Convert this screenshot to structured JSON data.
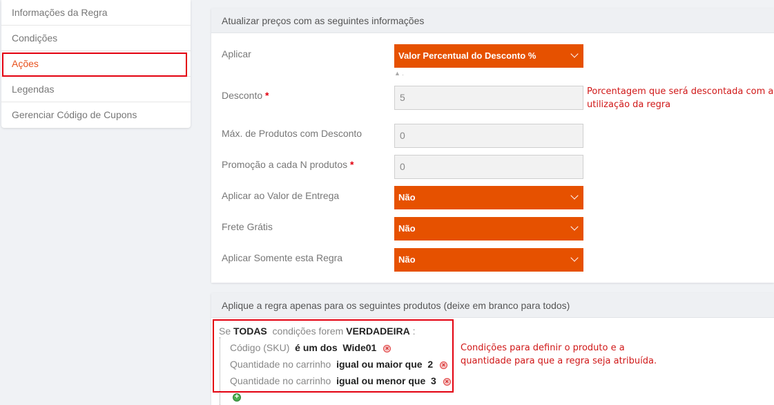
{
  "sidebar": {
    "items": [
      {
        "label": "Informações da Regra"
      },
      {
        "label": "Condições"
      },
      {
        "label": "Ações"
      },
      {
        "label": "Legendas"
      },
      {
        "label": "Gerenciar Código de Cupons"
      }
    ],
    "active_index": 2
  },
  "actions_panel": {
    "title": "Atualizar preços com as seguintes informações",
    "apply_label": "Aplicar",
    "apply_value": "Valor Percentual do Desconto %",
    "apply_hint": "▲ .",
    "discount_label": "Desconto",
    "discount_required": "*",
    "discount_value": "5",
    "discount_note_line1": "Porcentagem que será descontada com a",
    "discount_note_line2": "utilização da regra",
    "max_products_label": "Máx. de Produtos com Desconto",
    "max_products_value": "0",
    "promo_n_label": "Promoção a cada N produtos",
    "promo_n_required": "*",
    "promo_n_value": "0",
    "shipping_label": "Aplicar ao Valor de Entrega",
    "shipping_value": "Não",
    "free_shipping_label": "Frete Grátis",
    "free_shipping_value": "Não",
    "only_rule_label": "Aplicar Somente esta Regra",
    "only_rule_value": "Não"
  },
  "products_panel": {
    "title": "Aplique a regra apenas para os seguintes produtos (deixe em branco para todos)",
    "condition_head": {
      "se": "Se",
      "all": "TODAS",
      "mid": "condições forem",
      "truth": "VERDADEIRA",
      "colon": ":"
    },
    "conditions": [
      {
        "attr": "Código (SKU)",
        "op": "é um dos",
        "value": "Wide01"
      },
      {
        "attr": "Quantidade no carrinho",
        "op": "igual ou maior que",
        "value": "2"
      },
      {
        "attr": "Quantidade no carrinho",
        "op": "igual ou menor que",
        "value": "3"
      }
    ],
    "note_line1": "Condições para definir o produto e a",
    "note_line2": "quantidade para que a regra seja atribuída."
  },
  "icons": {
    "remove": "remove-x-icon",
    "add": "add-plus-icon",
    "dropdown": "chevron-down-icon"
  },
  "colors": {
    "accent": "#e65100",
    "highlight_border": "#e3000f",
    "note": "#d01818"
  }
}
